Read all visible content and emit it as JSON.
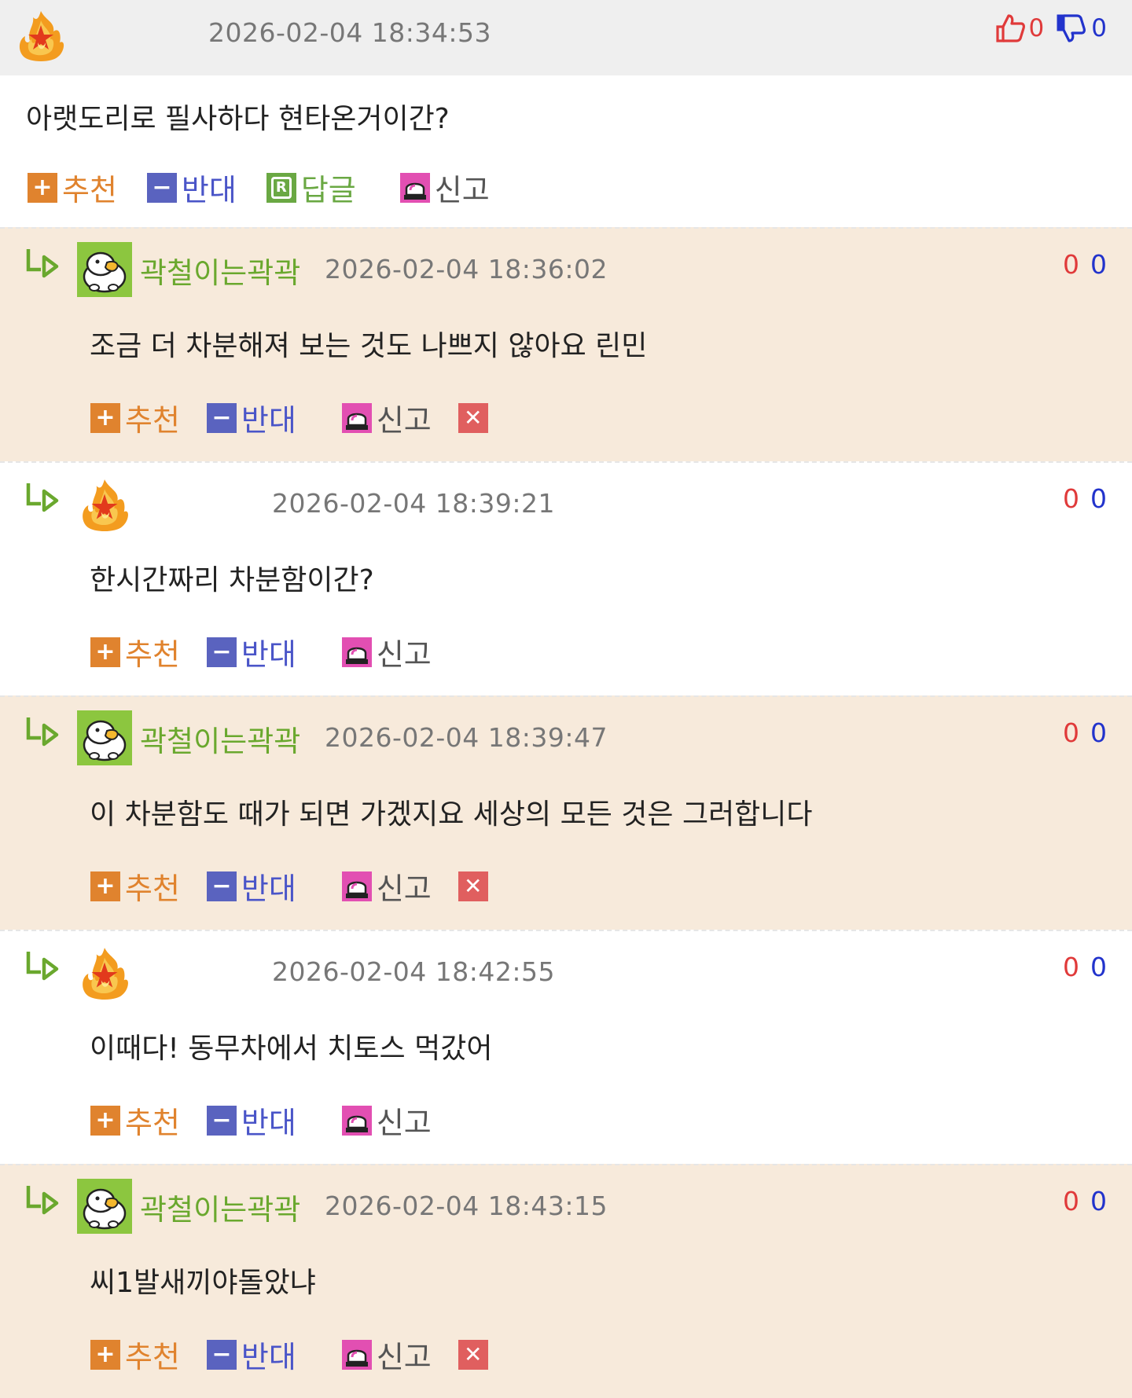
{
  "post": {
    "date": "2026-02-04 18:34:53",
    "likes": "0",
    "dislikes": "0",
    "content": "아랫도리로 필사하다 현타온거이간?",
    "actions": {
      "recommend": "추천",
      "oppose": "반대",
      "reply": "답글",
      "report": "신고"
    }
  },
  "labels": {
    "recommend": "추천",
    "oppose": "반대",
    "report": "신고"
  },
  "replies": [
    {
      "nick": "곽철이는곽곽",
      "date": "2026-02-04 18:36:02",
      "likes": "0",
      "dislikes": "0",
      "content": "조금 더 차분해져 보는 것도 나쁘지 않아요 린민"
    },
    {
      "nick": "",
      "date": "2026-02-04 18:39:21",
      "likes": "0",
      "dislikes": "0",
      "content": "한시간짜리 차분함이간?"
    },
    {
      "nick": "곽철이는곽곽",
      "date": "2026-02-04 18:39:47",
      "likes": "0",
      "dislikes": "0",
      "content": "이 차분함도 때가 되면 가겠지요 세상의 모든 것은 그러합니다"
    },
    {
      "nick": "",
      "date": "2026-02-04 18:42:55",
      "likes": "0",
      "dislikes": "0",
      "content": "이때다! 동무차에서 치토스 먹갔어"
    },
    {
      "nick": "곽철이는곽곽",
      "date": "2026-02-04 18:43:15",
      "likes": "0",
      "dislikes": "0",
      "content": "씨1발새끼야돌았냐"
    }
  ],
  "colors": {
    "recommend": "#e0832e",
    "oppose": "#5a63bf",
    "reply": "#6aa843",
    "report": "#e24fb2",
    "delete": "#e05f5f",
    "tan_bg": "#f7eadb"
  }
}
